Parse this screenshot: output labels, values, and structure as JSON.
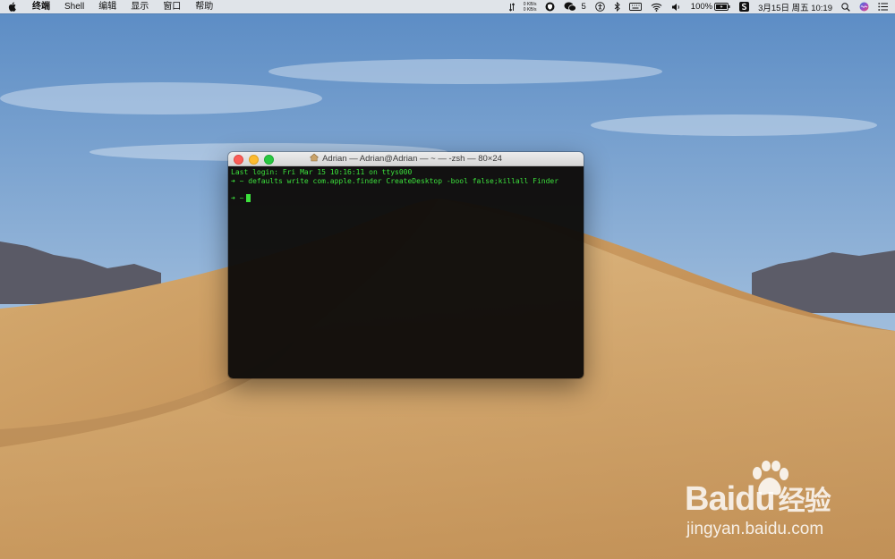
{
  "menubar": {
    "app_name": "终端",
    "menus": [
      "Shell",
      "编辑",
      "显示",
      "窗口",
      "帮助"
    ],
    "net_up": "0 KB/s",
    "net_down": "0 KB/s",
    "wechat_count": "5",
    "battery": "100%",
    "datetime": "3月15日 周五 10:19"
  },
  "terminal": {
    "title": "Adrian — Adrian@Adrian — ~ — -zsh — 80×24",
    "last_login": "Last login: Fri Mar 15 10:16:11 on ttys000",
    "prompt": "➜ ~",
    "command": "defaults write com.apple.finder CreateDesktop -bool false;killall Finder"
  },
  "watermark": {
    "brand": "Bai",
    "brand_suffix": "du",
    "brand_cn": "经验",
    "url": "jingyan.baidu.com"
  }
}
